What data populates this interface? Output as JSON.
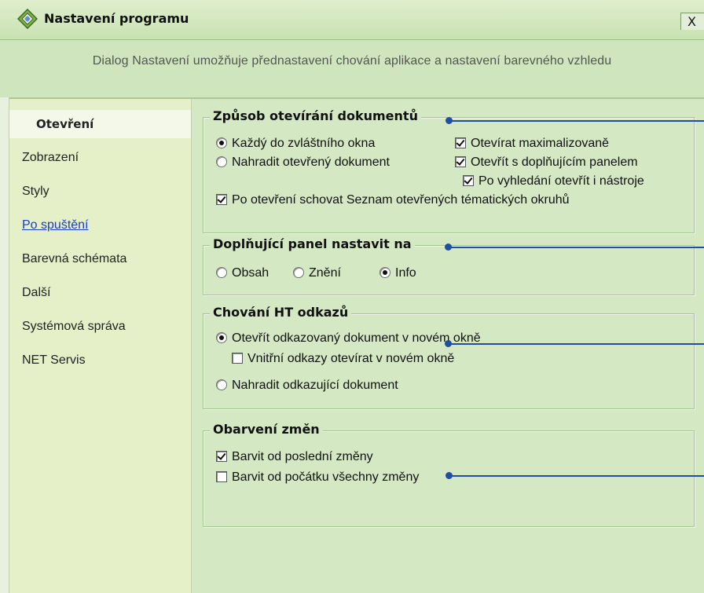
{
  "window": {
    "title": "Nastavení programu",
    "close_glyph": "X",
    "icon": "settings-diamond-icon",
    "accent": "#1f4fa3"
  },
  "header": {
    "description": "Dialog Nastavení umožňuje přednastavení chování aplikace a nastavení barevného vzhledu"
  },
  "sidebar": {
    "items": [
      {
        "label": "Otevření"
      },
      {
        "label": "Zobrazení"
      },
      {
        "label": "Styly"
      },
      {
        "label": "Po spuštění"
      },
      {
        "label": "Barevná schémata"
      },
      {
        "label": "Další"
      },
      {
        "label": "Systémová správa"
      },
      {
        "label": "NET Servis"
      }
    ]
  },
  "groups": {
    "open_mode": {
      "title": "Způsob otevírání dokumentů",
      "radio_each_window": {
        "label": "Každý do zvláštního okna",
        "checked": true
      },
      "radio_replace": {
        "label": "Nahradit otevřený dokument",
        "checked": false
      },
      "check_maximized": {
        "label": "Otevírat maximalizovaně",
        "checked": true
      },
      "check_panel": {
        "label": "Otevřít s doplňujícím panelem",
        "checked": true
      },
      "check_tools": {
        "label": "Po vyhledání otevřít i nástroje",
        "checked": true
      },
      "check_hide_list": {
        "label": "Po otevření schovat Seznam otevřených tématických okruhů",
        "checked": true
      }
    },
    "panel": {
      "title": "Doplňující panel nastavit na",
      "options": [
        {
          "label": "Obsah",
          "checked": false
        },
        {
          "label": "Znění",
          "checked": false
        },
        {
          "label": "Info",
          "checked": true
        }
      ]
    },
    "links": {
      "title": "Chování HT odkazů",
      "radio_new_window": {
        "label": "Otevřít odkazovaný dokument v novém okně",
        "checked": true
      },
      "check_internal": {
        "label": "Vnitřní odkazy otevírat v novém okně",
        "checked": false
      },
      "radio_replace": {
        "label": "Nahradit odkazující dokument",
        "checked": false
      }
    },
    "changes": {
      "title": "Obarvení změn",
      "check_last": {
        "label": "Barvit od poslední změny",
        "checked": true
      },
      "check_all": {
        "label": "Barvit od počátku všechny změny",
        "checked": false
      }
    }
  }
}
